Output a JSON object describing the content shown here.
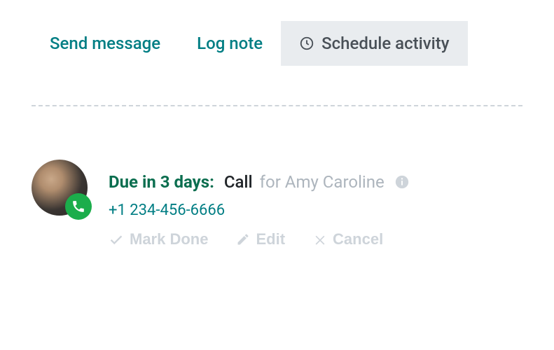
{
  "tabs": {
    "send_message": "Send message",
    "log_note": "Log note",
    "schedule_activity": "Schedule activity"
  },
  "activity": {
    "due": "Due in 3 days",
    "type": "Call",
    "for": "for Amy Caroline",
    "phone": "+1 234-456-6666"
  },
  "actions": {
    "mark_done": "Mark Done",
    "edit": "Edit",
    "cancel": "Cancel"
  }
}
